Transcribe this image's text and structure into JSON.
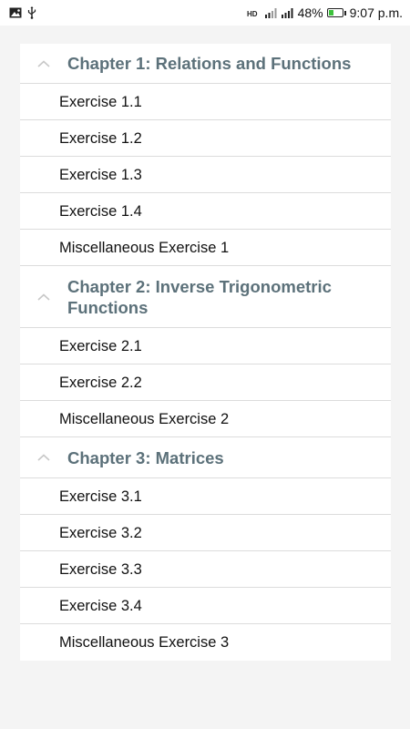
{
  "status_bar": {
    "left_icons": [
      "image-icon",
      "usb-icon"
    ],
    "hd_label": "HD",
    "battery_percent_text": "48%",
    "battery_level": 0.48,
    "time": "9:07 p.m."
  },
  "chapters": [
    {
      "title": "Chapter 1: Relations and Functions",
      "exercises": [
        "Exercise 1.1",
        "Exercise 1.2",
        "Exercise 1.3",
        "Exercise 1.4",
        "Miscellaneous Exercise 1"
      ]
    },
    {
      "title": "Chapter 2: Inverse Trigonometric Functions",
      "exercises": [
        "Exercise 2.1",
        "Exercise 2.2",
        "Miscellaneous Exercise 2"
      ]
    },
    {
      "title": "Chapter 3: Matrices",
      "exercises": [
        "Exercise 3.1",
        "Exercise 3.2",
        "Exercise 3.3",
        "Exercise 3.4",
        "Miscellaneous Exercise 3"
      ]
    }
  ]
}
